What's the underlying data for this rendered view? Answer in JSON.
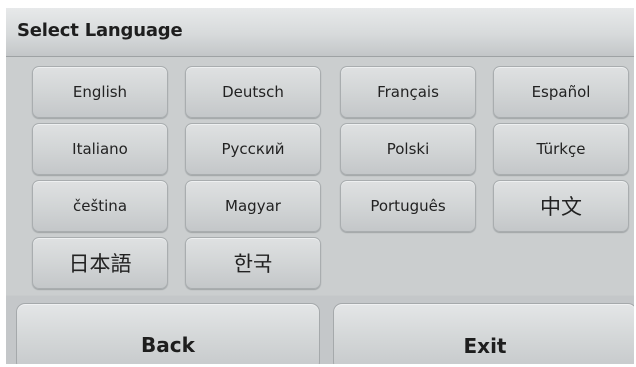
{
  "title": "Select Language",
  "languages": [
    "English",
    "Deutsch",
    "Français",
    "Español",
    "Italiano",
    "Русский",
    "Polski",
    "Türkçe",
    "čeština",
    "Magyar",
    "Português",
    "中文",
    "日本語",
    "한국"
  ],
  "buttons": {
    "back": "Back",
    "exit": "Exit"
  }
}
